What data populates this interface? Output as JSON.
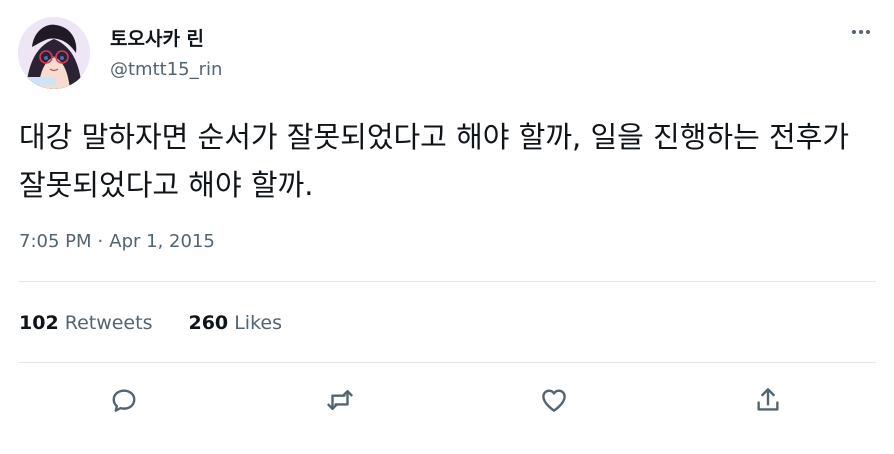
{
  "author": {
    "display_name": "토오사카 린",
    "handle": "@tmtt15_rin",
    "avatar_icon": "avatar-girl-with-glasses"
  },
  "tweet": {
    "text": "대강 말하자면 순서가 잘못되었다고 해야 할까, 일을 진행하는 전후가 잘못되었다고 해야 할까.",
    "time": "7:05 PM",
    "separator": "·",
    "date": "Apr 1, 2015"
  },
  "stats": {
    "retweets_count": "102",
    "retweets_label": "Retweets",
    "likes_count": "260",
    "likes_label": "Likes"
  },
  "actions": [
    {
      "icon": "reply-icon"
    },
    {
      "icon": "retweet-icon"
    },
    {
      "icon": "like-icon"
    },
    {
      "icon": "share-icon"
    }
  ],
  "colors": {
    "text_primary": "#0f1419",
    "text_secondary": "#536471",
    "divider": "#e4e7ea"
  }
}
